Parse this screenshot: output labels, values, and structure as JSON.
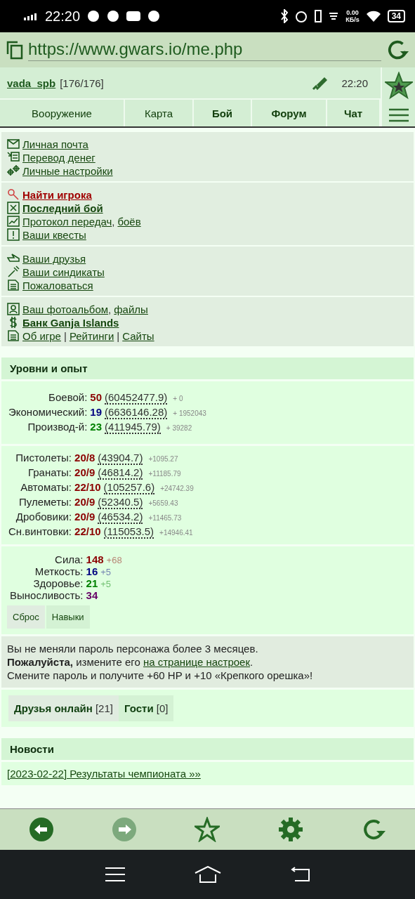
{
  "status_bar": {
    "time": "22:20",
    "speed": "0.00",
    "speed_unit": "КБ/s",
    "battery": "34"
  },
  "browser": {
    "url": "https://www.gwars.io/me.php"
  },
  "header": {
    "user": "vada_spb",
    "hp": "[176/176]",
    "time": "22:20"
  },
  "tabs": [
    {
      "label": "Вооружение",
      "bold": false
    },
    {
      "label": "Карта",
      "bold": false
    },
    {
      "label": "Бой",
      "bold": true
    },
    {
      "label": "Форум",
      "bold": true
    },
    {
      "label": "Чат",
      "bold": true
    }
  ],
  "menu_groups": [
    [
      {
        "kind": "mail",
        "bold": false,
        "color": "#16470f",
        "parts": [
          {
            "kind": "link",
            "text": "Личная почта"
          }
        ]
      },
      {
        "kind": "transfer",
        "bold": false,
        "color": "#16470f",
        "parts": [
          {
            "kind": "link",
            "text": "Перевод денег"
          }
        ]
      },
      {
        "kind": "gears",
        "bold": false,
        "color": "#16470f",
        "parts": [
          {
            "kind": "link",
            "text": "Личные настройки"
          }
        ]
      }
    ],
    [
      {
        "kind": "search",
        "bold": true,
        "color": "#a00000",
        "parts": [
          {
            "kind": "link",
            "text": "Найти игрока"
          }
        ]
      },
      {
        "kind": "battle",
        "bold": true,
        "color": "#16470f",
        "parts": [
          {
            "kind": "link",
            "text": "Последний бой"
          }
        ]
      },
      {
        "kind": "chart",
        "bold": false,
        "color": "#16470f",
        "parts": [
          {
            "kind": "link",
            "text": "Протокол передач"
          },
          {
            "kind": "sep",
            "text": ","
          },
          {
            "kind": "link",
            "text": "боёв"
          }
        ]
      },
      {
        "kind": "quest",
        "bold": false,
        "color": "#16470f",
        "parts": [
          {
            "kind": "link",
            "text": "Ваши квесты"
          }
        ]
      }
    ],
    [
      {
        "kind": "hand",
        "bold": false,
        "color": "#16470f",
        "parts": [
          {
            "kind": "link",
            "text": "Ваши друзья"
          }
        ]
      },
      {
        "kind": "knife",
        "bold": false,
        "color": "#16470f",
        "parts": [
          {
            "kind": "link",
            "text": "Ваши синдикаты"
          }
        ]
      },
      {
        "kind": "doc",
        "bold": false,
        "color": "#16470f",
        "parts": [
          {
            "kind": "link",
            "text": "Пожаловаться"
          }
        ]
      }
    ],
    [
      {
        "kind": "photo",
        "bold": false,
        "color": "#16470f",
        "parts": [
          {
            "kind": "link",
            "text": "Ваш фотоальбом"
          },
          {
            "kind": "sep",
            "text": ","
          },
          {
            "kind": "link",
            "text": "файлы"
          }
        ]
      },
      {
        "kind": "dollar",
        "bold": true,
        "color": "#16470f",
        "parts": [
          {
            "kind": "link",
            "text": "Банк Ganja Islands"
          }
        ]
      },
      {
        "kind": "doc",
        "bold": false,
        "color": "#16470f",
        "parts": [
          {
            "kind": "link",
            "text": "Об игре"
          },
          {
            "kind": "sep",
            "text": "|"
          },
          {
            "kind": "link",
            "text": "Рейтинги"
          },
          {
            "kind": "sep",
            "text": "|"
          },
          {
            "kind": "link",
            "text": "Сайты"
          }
        ]
      }
    ]
  ],
  "levels": {
    "title": "Уровни и опыт",
    "rows": [
      {
        "label": "Боевой:",
        "value": "50",
        "exp": "(60452477.9)",
        "gain": "+ 0",
        "color": "#8b0000"
      },
      {
        "label": "Экономический:",
        "value": "19",
        "exp": "(6636146.28)",
        "gain": "+ 1952043",
        "color": "#000080"
      },
      {
        "label": "Производ-й:",
        "value": "23",
        "exp": "(411945.79)",
        "gain": "+ 39282",
        "color": "#008000"
      }
    ],
    "skills": [
      {
        "label": "Пистолеты:",
        "value": "20/8",
        "exp": "(43904.7)",
        "gain": "+1095.27",
        "color": "#8b0000"
      },
      {
        "label": "Гранаты:",
        "value": "20/9",
        "exp": "(46814.2)",
        "gain": "+11185.79",
        "color": "#8b0000"
      },
      {
        "label": "Автоматы:",
        "value": "22/10",
        "exp": "(105257.6)",
        "gain": "+24742.39",
        "color": "#8b0000"
      },
      {
        "label": "Пулеметы:",
        "value": "20/9",
        "exp": "(52340.5)",
        "gain": "+5659.43",
        "color": "#8b0000"
      },
      {
        "label": "Дробовики:",
        "value": "20/9",
        "exp": "(46534.2)",
        "gain": "+11465.73",
        "color": "#8b0000"
      },
      {
        "label": "Сн.винтовки:",
        "value": "22/10",
        "exp": "(115053.5)",
        "gain": "+14946.41",
        "color": "#8b0000"
      }
    ],
    "stats": [
      {
        "label": "Сила:",
        "value": "148",
        "bonus": "+68",
        "color": "#8b0000"
      },
      {
        "label": "Меткость:",
        "value": "16",
        "bonus": "+5",
        "color": "#000080"
      },
      {
        "label": "Здоровье:",
        "value": "21",
        "bonus": "+5",
        "color": "#008000"
      },
      {
        "label": "Выносливость:",
        "value": "34",
        "color": "#660066"
      }
    ],
    "buttons": [
      {
        "label": "Сброс",
        "selected": true
      },
      {
        "label": "Навыки",
        "selected": false
      }
    ]
  },
  "notice": {
    "line1": "Вы не меняли пароль персонажа более 3 месяцев.",
    "line2_before": "**Пожалуйста,** измените его",
    "line2_link": "на странице настроек",
    "line2_after": ".",
    "line3": "Смените пароль и получите +60 HP и +10 «Крепкого орешка»!"
  },
  "friends_tabs": [
    {
      "label": "Друзья онлайн",
      "count": "[21]",
      "selected": true
    },
    {
      "label": "Гости",
      "count": "[0]",
      "selected": false
    }
  ],
  "news": {
    "title": "Новости",
    "items": [
      "[2023-02-22] Результаты чемпионата »»"
    ]
  },
  "toolbar": [
    {
      "kind": "back",
      "disabled": false
    },
    {
      "kind": "forward",
      "disabled": true
    },
    {
      "kind": "star",
      "disabled": false
    },
    {
      "kind": "settings",
      "disabled": false
    },
    {
      "kind": "reload",
      "disabled": false
    }
  ]
}
